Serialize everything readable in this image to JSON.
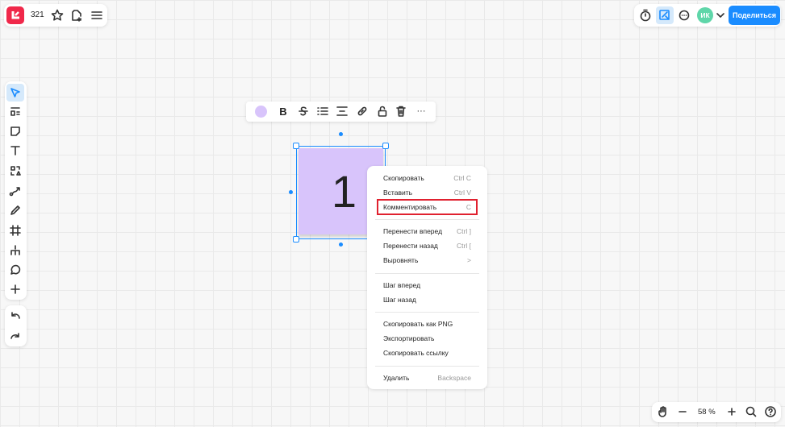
{
  "header": {
    "board_number": "321",
    "share_label": "Поделиться",
    "avatar_initials": "ИК"
  },
  "note": {
    "text": "1",
    "color": "#d8c4fb"
  },
  "context_menu": {
    "items": [
      {
        "label": "Скопировать",
        "shortcut": "Ctrl C"
      },
      {
        "label": "Вставить",
        "shortcut": "Ctrl V"
      },
      {
        "label": "Комментировать",
        "shortcut": "C"
      },
      {
        "label": "Перенести вперед",
        "shortcut": "Ctrl ]"
      },
      {
        "label": "Перенести назад",
        "shortcut": "Ctrl ["
      },
      {
        "label": "Выровнять",
        "shortcut": ">"
      },
      {
        "label": "Шаг вперед",
        "shortcut": ""
      },
      {
        "label": "Шаг назад",
        "shortcut": ""
      },
      {
        "label": "Скопировать как PNG",
        "shortcut": ""
      },
      {
        "label": "Экспортировать",
        "shortcut": ""
      },
      {
        "label": "Скопировать ссылку",
        "shortcut": ""
      },
      {
        "label": "Удалить",
        "shortcut": "Backspace"
      }
    ]
  },
  "zoom": {
    "level": "58 %"
  },
  "colors": {
    "accent": "#1a8cff",
    "brand": "#f0284a",
    "highlight": "#e0212f"
  }
}
